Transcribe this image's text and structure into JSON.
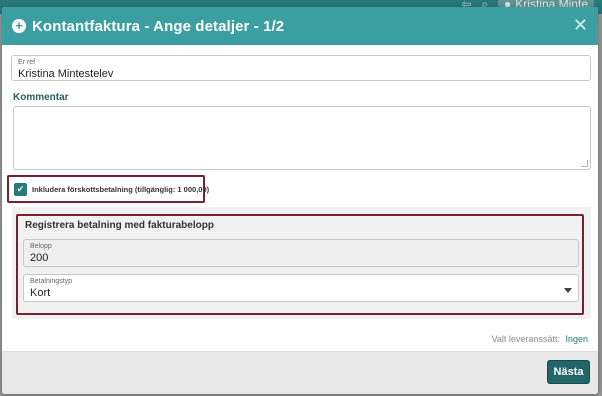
{
  "background": {
    "user_name": "Kristina Minte",
    "user_icon": "user-icon",
    "search_icon": "search-icon",
    "back_icon": "back-icon"
  },
  "modal": {
    "title": "Kontantfaktura - Ange detaljer - 1/2",
    "header_color": "#3b9ea0",
    "close_icon": "close-icon",
    "plus_icon": "plus-circle-icon"
  },
  "form": {
    "reference": {
      "label": "Er ref",
      "value": "Kristina Mintestelev"
    },
    "comment": {
      "label": "Kommentar",
      "value": ""
    },
    "prepayment": {
      "checked": true,
      "label": "Inkludera förskottsbetalning (tillgänglig: 1 000,00)"
    },
    "payment": {
      "title": "Registrera betalning med fakturabelopp",
      "amount": {
        "label": "Belopp",
        "value": "200"
      },
      "type": {
        "label": "Betalningstyp",
        "value": "Kort"
      }
    },
    "delivery": {
      "label": "Valt leveranssätt:",
      "value": "Ingen"
    }
  },
  "footer": {
    "next_label": "Nästa",
    "accent": "#22666a"
  },
  "highlight_color": "#7b1f32"
}
